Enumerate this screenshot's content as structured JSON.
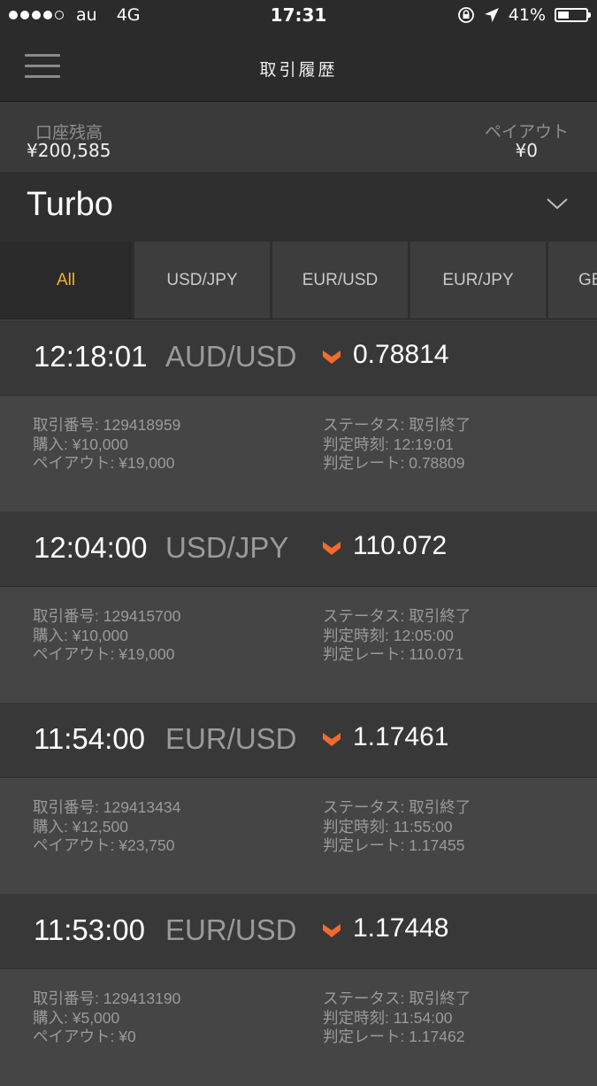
{
  "status_bar": {
    "carrier": "au",
    "network": "4G",
    "time": "17:31",
    "battery": "41%",
    "battery_level": 0.41,
    "signal_bars": 4
  },
  "nav": {
    "title": "取引履歴",
    "menu_icon": "hamburger-icon"
  },
  "account": {
    "balance_label": "口座残高",
    "balance_value": "¥200,585",
    "payout_label": "ペイアウト",
    "payout_value": "¥0"
  },
  "product": {
    "name": "Turbo",
    "dropdown_icon": "chevron-down-icon"
  },
  "tabs": [
    {
      "label": "All",
      "active": true
    },
    {
      "label": "USD/JPY",
      "active": false
    },
    {
      "label": "EUR/USD",
      "active": false
    },
    {
      "label": "EUR/JPY",
      "active": false
    },
    {
      "label": "GB",
      "active": false
    }
  ],
  "colors": {
    "accent": "#f5b026",
    "direction_arrow": "#f26a2e",
    "background": "#424242"
  },
  "trades": [
    {
      "time": "12:18:01",
      "pair": "AUD/USD",
      "direction": "down",
      "rate": "0.78814",
      "trade_no": "取引番号: 129418959",
      "purchase": "購入: ¥10,000",
      "payout": "ペイアウト: ¥19,000",
      "status": "ステータス: 取引終了",
      "judge_time": "判定時刻: 12:19:01",
      "judge_rate": "判定レート: 0.78809"
    },
    {
      "time": "12:04:00",
      "pair": "USD/JPY",
      "direction": "down",
      "rate": "110.072",
      "trade_no": "取引番号: 129415700",
      "purchase": "購入: ¥10,000",
      "payout": "ペイアウト: ¥19,000",
      "status": "ステータス: 取引終了",
      "judge_time": "判定時刻: 12:05:00",
      "judge_rate": "判定レート: 110.071"
    },
    {
      "time": "11:54:00",
      "pair": "EUR/USD",
      "direction": "down",
      "rate": "1.17461",
      "trade_no": "取引番号: 129413434",
      "purchase": "購入: ¥12,500",
      "payout": "ペイアウト: ¥23,750",
      "status": "ステータス: 取引終了",
      "judge_time": "判定時刻: 11:55:00",
      "judge_rate": "判定レート: 1.17455"
    },
    {
      "time": "11:53:00",
      "pair": "EUR/USD",
      "direction": "down",
      "rate": "1.17448",
      "trade_no": "取引番号: 129413190",
      "purchase": "購入: ¥5,000",
      "payout": "ペイアウト: ¥0",
      "status": "ステータス: 取引終了",
      "judge_time": "判定時刻: 11:54:00",
      "judge_rate": "判定レート: 1.17462"
    }
  ]
}
